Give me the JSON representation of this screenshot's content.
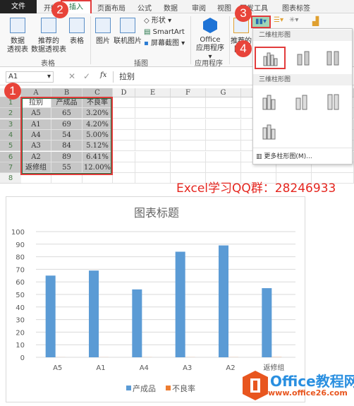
{
  "tabs": [
    "文件",
    "开始",
    "插入",
    "页面布局",
    "公式",
    "数据",
    "审阅",
    "视图",
    "开发工具",
    "图表标签"
  ],
  "ribbon": {
    "pivot": "数据\n透视表",
    "recommended_pivot": "推荐的\n数据透视表",
    "table": "表格",
    "group_tables": "表格",
    "picture": "图片",
    "online_picture": "联机图片",
    "shapes": "形状",
    "smartart": "SmartArt",
    "screenshot": "屏幕截图",
    "group_illustrations": "插图",
    "office_apps_1": "Office",
    "office_apps_2": "应用程序",
    "group_apps": "应用程序",
    "recommended_charts": "推荐的\n图表"
  },
  "formula_bar": {
    "name_box": "A1",
    "value": "拉别",
    "fx": "fx"
  },
  "columns": [
    "A",
    "B",
    "C",
    "D",
    "E",
    "F",
    "G"
  ],
  "rows": [
    [
      "拉别",
      "产成品",
      "不良率"
    ],
    [
      "A5",
      "65",
      "3.20%"
    ],
    [
      "A1",
      "69",
      "4.20%"
    ],
    [
      "A4",
      "54",
      "5.00%"
    ],
    [
      "A3",
      "84",
      "5.12%"
    ],
    [
      "A2",
      "89",
      "6.41%"
    ],
    [
      "返修组",
      "55",
      "12.00%"
    ]
  ],
  "dropdown": {
    "section_2d": "二维柱形图",
    "section_3d": "三维柱形图",
    "more": "更多柱形图(M)..."
  },
  "badges": [
    "1",
    "2",
    "3",
    "4"
  ],
  "watermark_text": "Excel学习QQ群：28246933",
  "logo": {
    "name": "Office教程网",
    "url": "www.office26.com"
  },
  "colors": {
    "accent": "#217346",
    "series1": "#5b9bd5",
    "series2": "#ed7d31",
    "annotation": "#e5261f"
  },
  "chart_data": {
    "type": "bar",
    "title": "图表标题",
    "categories": [
      "A5",
      "A1",
      "A4",
      "A3",
      "A2",
      "返修组"
    ],
    "series": [
      {
        "name": "产成品",
        "values": [
          65,
          69,
          54,
          84,
          89,
          55
        ],
        "color": "#5b9bd5"
      },
      {
        "name": "不良率",
        "values": [
          0.032,
          0.042,
          0.05,
          0.0512,
          0.0641,
          0.12
        ],
        "color": "#ed7d31"
      }
    ],
    "ylim": [
      0,
      100
    ],
    "yticks": [
      "0",
      "10",
      "20",
      "30",
      "40",
      "50",
      "60",
      "70",
      "80",
      "90",
      "100"
    ],
    "grid": true,
    "legend": "bottom"
  }
}
